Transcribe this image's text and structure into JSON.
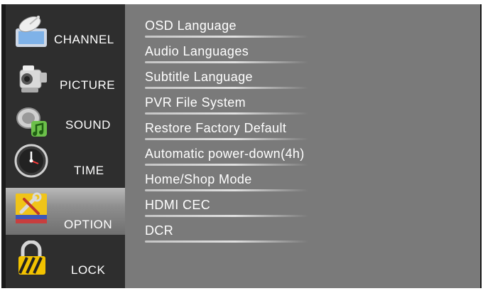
{
  "sidebar": {
    "items": [
      {
        "label": "CHANNEL",
        "icon": "satellite-dish-icon"
      },
      {
        "label": "PICTURE",
        "icon": "camcorder-icon"
      },
      {
        "label": "SOUND",
        "icon": "speaker-music-icon"
      },
      {
        "label": "TIME",
        "icon": "clock-icon"
      },
      {
        "label": "OPTION",
        "icon": "tools-icon",
        "selected": true
      },
      {
        "label": "LOCK",
        "icon": "padlock-icon"
      }
    ]
  },
  "menu": {
    "items": [
      {
        "label": "OSD Language"
      },
      {
        "label": "Audio Languages"
      },
      {
        "label": "Subtitle Language"
      },
      {
        "label": "PVR File System"
      },
      {
        "label": "Restore Factory Default"
      },
      {
        "label": "Automatic power-down(4h)"
      },
      {
        "label": "Home/Shop Mode"
      },
      {
        "label": "HDMI CEC"
      },
      {
        "label": "DCR"
      }
    ]
  },
  "colors": {
    "content_background": "#7a7a7a",
    "sidebar_background": "#2e2e2e",
    "selected_highlight": "#a8a8a8",
    "text": "#ffffff"
  }
}
